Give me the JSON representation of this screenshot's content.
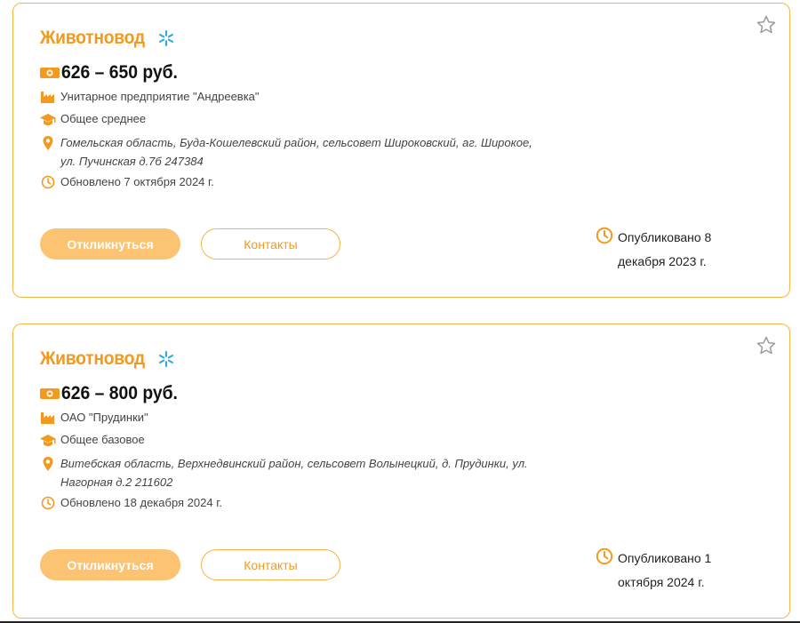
{
  "accent_color": "#f39a1e",
  "jobs": [
    {
      "title": "Животновод",
      "salary": "626 – 650 руб.",
      "company": "Унитарное предприятие \"Андреевка\"",
      "education": "Общее среднее",
      "address_line1": "Гомельская область, Буда-Кошелевский район, сельсовет Широковский, аг. Широкое,",
      "address_line2": "ул. Пучинская д.7б 247384",
      "updated": "Обновлено 7 октября 2024 г.",
      "apply_label": "Откликнуться",
      "contacts_label": "Контакты",
      "published_line1": "Опубликовано 8",
      "published_line2": "декабря 2023 г."
    },
    {
      "title": "Животновод",
      "salary": "626 – 800 руб.",
      "company": "ОАО \"Прудинки\"",
      "education": "Общее базовое",
      "address_line1": "Витебская область, Верхнедвинский район, сельсовет Волынецкий, д. Прудинки, ул.",
      "address_line2": "Нагорная д.2 211602",
      "updated": "Обновлено 18 декабря 2024 г.",
      "apply_label": "Откликнуться",
      "contacts_label": "Контакты",
      "published_line1": "Опубликовано 1",
      "published_line2": "октября 2024 г."
    }
  ],
  "icons": [
    "spark-icon",
    "star-icon",
    "money-icon",
    "factory-icon",
    "graduation-cap-icon",
    "location-pin-icon",
    "clock-icon"
  ]
}
